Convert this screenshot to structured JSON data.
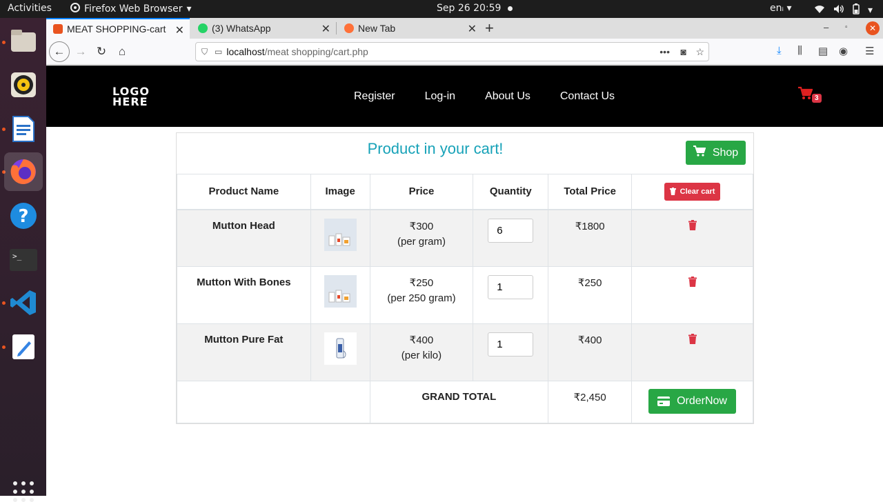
{
  "system": {
    "activities": "Activities",
    "app_name": "Firefox Web Browser",
    "clock": "Sep 26  20:59",
    "lang": "en"
  },
  "browser": {
    "tabs": [
      {
        "title": "MEAT SHOPPING-cart",
        "active": true
      },
      {
        "title": "(3) WhatsApp",
        "active": false
      },
      {
        "title": "New Tab",
        "active": false
      }
    ],
    "url_host": "localhost",
    "url_path": "/meat shopping/cart.php"
  },
  "site": {
    "logo_line1": "LOGO",
    "logo_line2": "HERE",
    "nav": [
      "Register",
      "Log-in",
      "About Us",
      "Contact Us"
    ],
    "cart_count": "3"
  },
  "cart": {
    "title": "Product in your cart!",
    "shop_label": "Shop",
    "headers": [
      "Product Name",
      "Image",
      "Price",
      "Quantity",
      "Total Price"
    ],
    "clear_label": "Clear cart",
    "items": [
      {
        "name": "Mutton Head",
        "price": "₹300",
        "unit": "(per gram)",
        "qty": "6",
        "total": "₹1800"
      },
      {
        "name": "Mutton With Bones",
        "price": "₹250",
        "unit": "(per 250 gram)",
        "qty": "1",
        "total": "₹250"
      },
      {
        "name": "Mutton Pure Fat",
        "price": "₹400",
        "unit": "(per kilo)",
        "qty": "1",
        "total": "₹400"
      }
    ],
    "grand_total_label": "GRAND TOTAL",
    "grand_total": "₹2,450",
    "order_label": "OrderNow"
  },
  "colors": {
    "accent": "#17a2b8",
    "success": "#28a745",
    "danger": "#dc3545"
  }
}
